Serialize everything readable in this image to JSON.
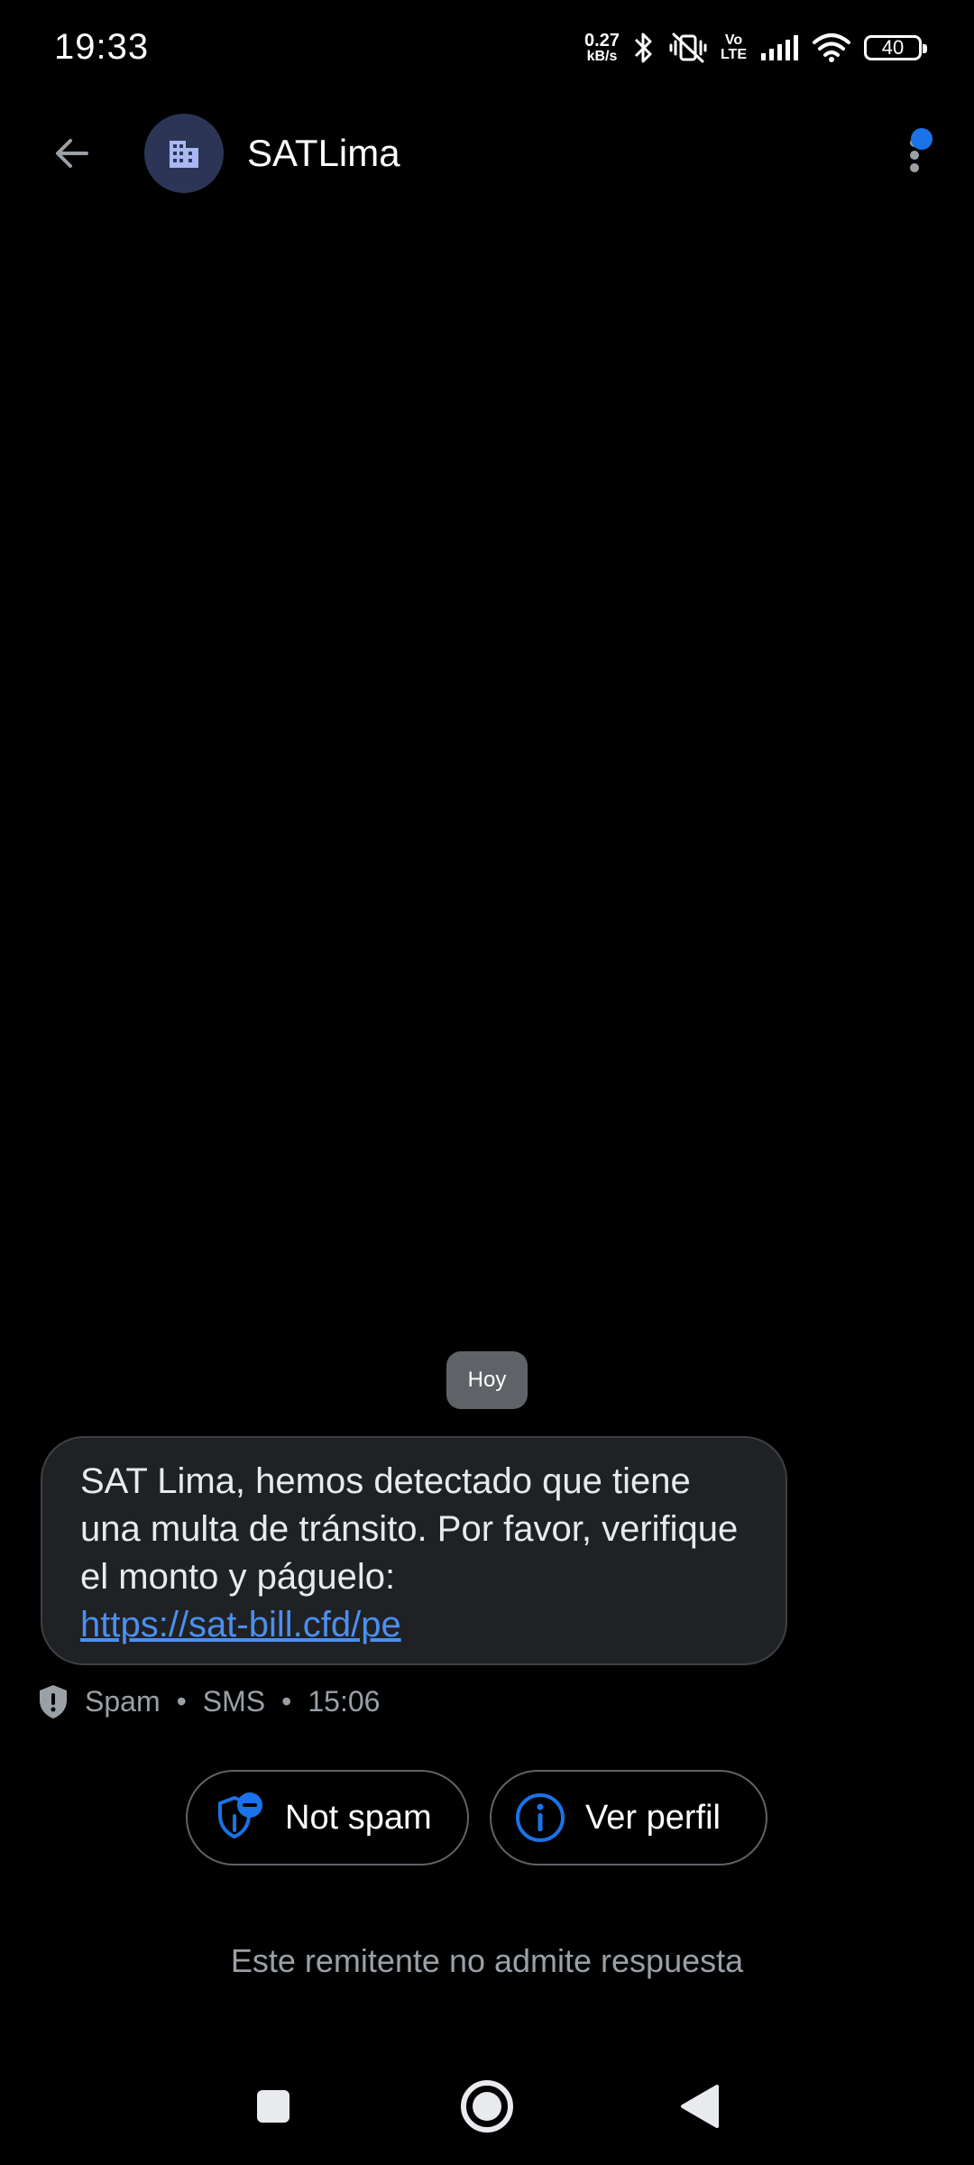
{
  "status_bar": {
    "time": "19:33",
    "net_speed_value": "0.27",
    "net_speed_unit": "kB/s",
    "volte_top": "Vo",
    "volte_bottom": "LTE",
    "battery": "40",
    "icons": [
      "bluetooth-icon",
      "vibrate-off-icon",
      "volte-icon",
      "signal-icon",
      "wifi-icon",
      "battery-icon"
    ]
  },
  "header": {
    "contact_name": "SATLima",
    "avatar_icon": "building-icon",
    "notification_color": "#1a73e8"
  },
  "conversation": {
    "date_chip": "Hoy",
    "message": {
      "text": "SAT Lima, hemos detectado que tiene una multa de tránsito. Por favor, verifique el monto y páguelo:",
      "link": "https://sat-bill.cfd/pe",
      "label": "Spam",
      "type": "SMS",
      "time": "15:06"
    },
    "separator": "•"
  },
  "actions": {
    "not_spam": "Not spam",
    "ver_perfil": "Ver perfil"
  },
  "footer_note": "Este remitente no admite respuesta",
  "colors": {
    "background": "#000000",
    "bubble": "#202124",
    "link": "#4a90f0",
    "accent": "#1a73e8",
    "muted_text": "#9aa0a6"
  }
}
